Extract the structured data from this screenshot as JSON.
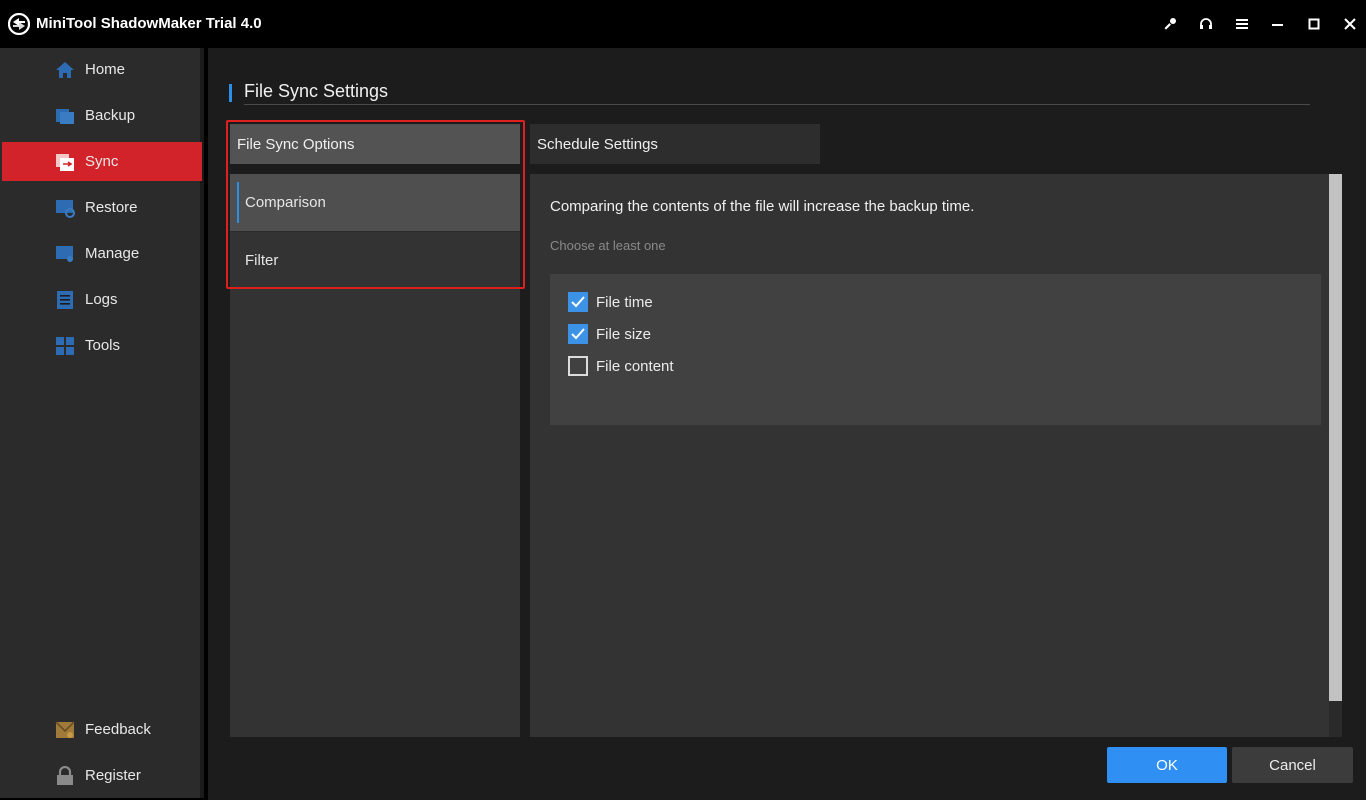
{
  "app": {
    "title": "MiniTool ShadowMaker Trial 4.0"
  },
  "titlebar_icons": [
    "key-icon",
    "headset-icon",
    "menu-icon",
    "minimize-icon",
    "maximize-icon",
    "close-icon"
  ],
  "sidebar": {
    "items": [
      {
        "label": "Home",
        "icon": "home-icon"
      },
      {
        "label": "Backup",
        "icon": "backup-icon"
      },
      {
        "label": "Sync",
        "icon": "sync-icon",
        "active": true
      },
      {
        "label": "Restore",
        "icon": "restore-icon"
      },
      {
        "label": "Manage",
        "icon": "manage-icon"
      },
      {
        "label": "Logs",
        "icon": "logs-icon"
      },
      {
        "label": "Tools",
        "icon": "tools-icon"
      }
    ],
    "bottom_items": [
      {
        "label": "Feedback",
        "icon": "feedback-icon"
      },
      {
        "label": "Register",
        "icon": "lock-icon"
      }
    ]
  },
  "page": {
    "title": "File Sync Settings",
    "tabs": [
      {
        "label": "File Sync Options",
        "active": true
      },
      {
        "label": "Schedule Settings",
        "active": false
      }
    ],
    "sub_items": [
      {
        "label": "Comparison",
        "active": true
      },
      {
        "label": "Filter",
        "active": false
      }
    ],
    "description": "Comparing the contents of the file will increase the backup time.",
    "hint": "Choose at least one",
    "options": [
      {
        "label": "File time",
        "checked": true
      },
      {
        "label": "File size",
        "checked": true
      },
      {
        "label": "File content",
        "checked": false
      }
    ],
    "buttons": {
      "ok": "OK",
      "cancel": "Cancel"
    }
  },
  "colors": {
    "accent": "#2f8ff2",
    "active_nav": "#d2232a",
    "highlight": "#e0201f"
  }
}
